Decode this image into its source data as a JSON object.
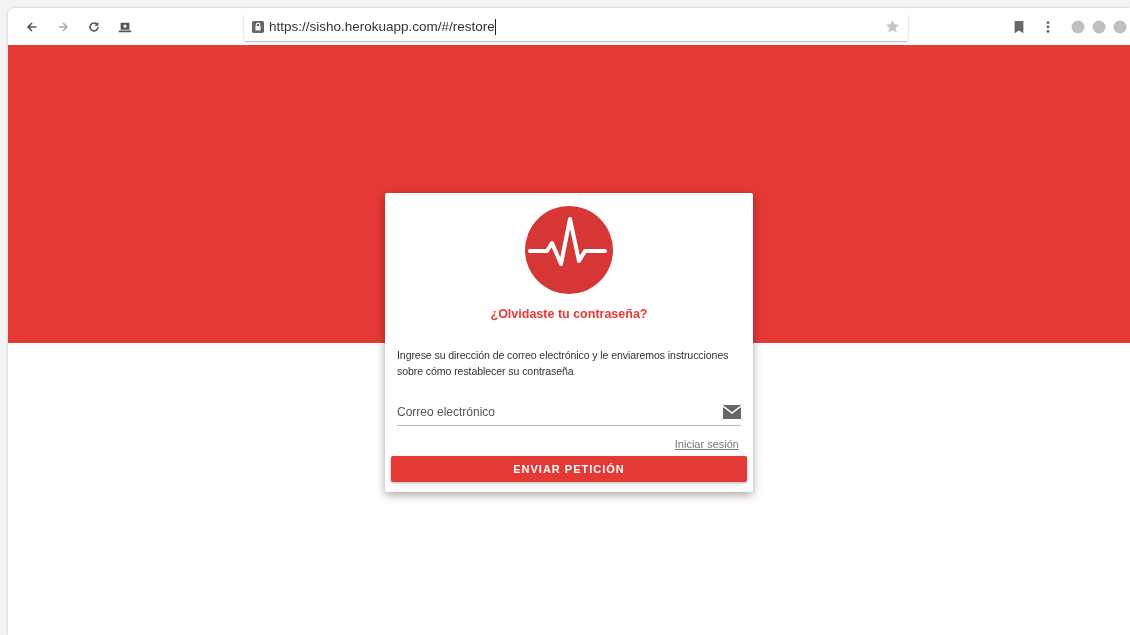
{
  "browser": {
    "url": "https://sisho.herokuapp.com/#/restore",
    "forward_disabled": true
  },
  "card": {
    "title": "¿Olvidaste tu contraseña?",
    "description": "Ingrese su dirección de correo electrónico y le enviaremos instrucciones sobre cómo restablecer su contraseña",
    "email_placeholder": "Correo electrónico",
    "login_link": "Iniciar sesión",
    "submit": "ENVIAR PETICIÓN"
  }
}
